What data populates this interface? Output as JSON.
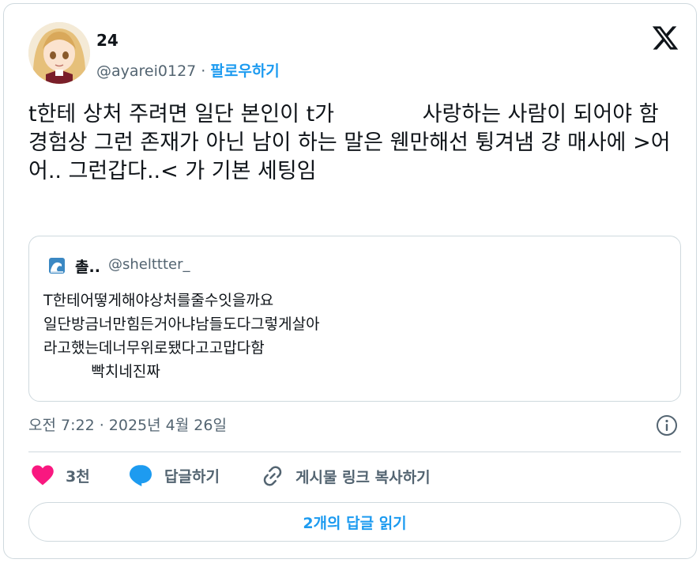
{
  "author": {
    "name": "24",
    "handle": "@ayarei0127",
    "separator": "·",
    "follow_label": "팔로우하기"
  },
  "tweet": {
    "text": "t한테 상처 주려면 일단 본인이 t가             사랑하는 사람이 되어야 함\n경험상 그런 존재가 아닌 남이 하는 말은 웬만해선 튕겨냄 걍 매사에 >어어.. 그런갑다..< 가 기본 세팅임"
  },
  "quote": {
    "name": "촐..",
    "handle": "@shelttter_",
    "text": "T한테어떻게해야상처를줄수잇을까요\n일단방금너만힘든거아냐남들도다그렇게살아\n라고했는데너무위로됐다고고맙다함\n          빡치네진짜"
  },
  "meta": {
    "timestamp": "오전 7:22 · 2025년 4월 26일"
  },
  "actions": {
    "like_count": "3천",
    "reply_label": "답글하기",
    "copy_label": "게시물 링크 복사하기"
  },
  "replies_button": "2개의 답글 읽기",
  "colors": {
    "accent": "#1d9bf0",
    "like": "#f91880",
    "text": "#0f1419",
    "secondary": "#536471",
    "border": "#cfd9de"
  }
}
